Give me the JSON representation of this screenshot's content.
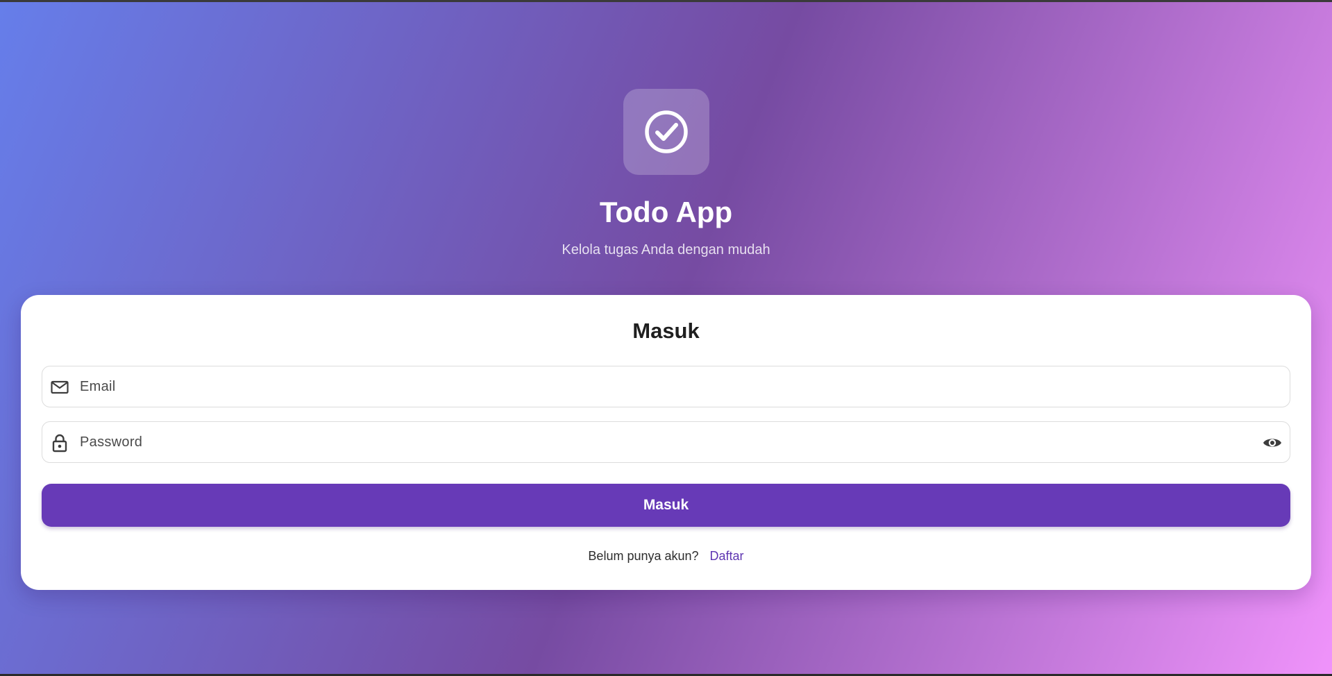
{
  "app": {
    "title": "Todo App",
    "subtitle": "Kelola tugas Anda dengan mudah",
    "logo_icon": "check-circle-icon"
  },
  "login_card": {
    "title": "Masuk",
    "email": {
      "placeholder": "Email",
      "value": "",
      "icon": "mail-icon"
    },
    "password": {
      "placeholder": "Password",
      "value": "",
      "icon": "lock-icon",
      "toggle_icon": "eye-icon"
    },
    "submit_label": "Masuk",
    "register_prompt": "Belum punya akun?",
    "register_link": "Daftar"
  },
  "colors": {
    "gradient_start": "#667eea",
    "gradient_mid": "#764ba2",
    "gradient_end": "#f093fb",
    "primary": "#673ab7",
    "link": "#5e35b1"
  }
}
